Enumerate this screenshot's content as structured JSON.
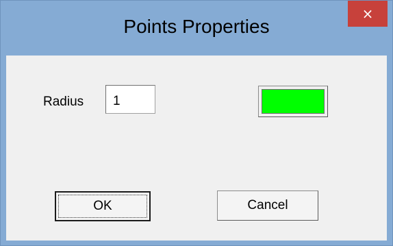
{
  "window": {
    "title": "Points Properties",
    "close_symbol": "×"
  },
  "form": {
    "radius_label": "Radius",
    "radius_value": "1",
    "point_color": "#00ff00"
  },
  "buttons": {
    "ok_label": "OK",
    "cancel_label": "Cancel"
  },
  "colors": {
    "titlebar": "#85abd4",
    "close_button": "#c7413b",
    "client_background": "#f0f0f0"
  }
}
